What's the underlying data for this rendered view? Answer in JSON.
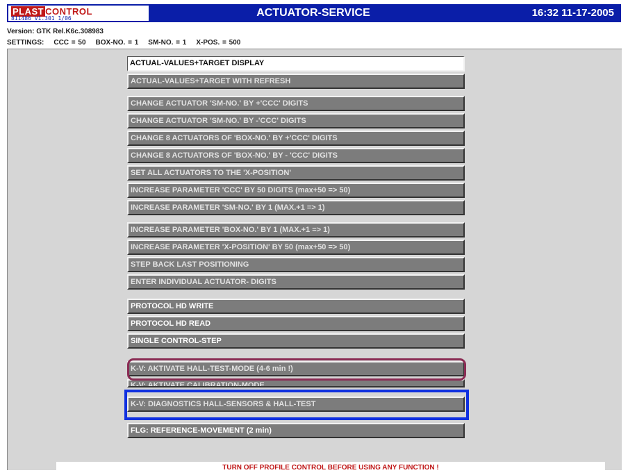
{
  "header": {
    "logo": {
      "part1": "PLAST",
      "part2": "CONTROL",
      "subline": "811486 V1.301 1/06"
    },
    "title": "ACTUATOR-SERVICE",
    "clock": "16:32 11-17-2005"
  },
  "version": "Version: GTK Rel.K6c.308983",
  "settings": {
    "label": "SETTINGS:",
    "ccc": "CCC = 50",
    "box_no": "BOX-NO. = 1",
    "sm_no": "SM-NO. = 1",
    "x_pos": "X-POS. = 500"
  },
  "menu": [
    "ACTUAL-VALUES+TARGET DISPLAY",
    "ACTUAL-VALUES+TARGET WITH REFRESH",
    "CHANGE ACTUATOR 'SM-NO.' BY +'CCC' DIGITS",
    "CHANGE ACTUATOR 'SM-NO.' BY -'CCC' DIGITS",
    "CHANGE 8 ACTUATORS OF 'BOX-NO.' BY +'CCC' DIGITS",
    "CHANGE 8 ACTUATORS OF 'BOX-NO.' BY - 'CCC' DIGITS",
    "SET ALL ACTUATORS TO THE 'X-POSITION'",
    "INCREASE PARAMETER 'CCC' BY 50 DIGITS (max+50 => 50)",
    "INCREASE PARAMETER 'SM-NO.' BY 1 (MAX.+1 => 1)",
    "INCREASE PARAMETER 'BOX-NO.' BY 1 (MAX.+1 => 1)",
    "INCREASE PARAMETER 'X-POSITION' BY 50 (max+50 => 50)",
    "STEP BACK LAST POSITIONING",
    "ENTER INDIVIDUAL ACTUATOR- DIGITS",
    "PROTOCOL HD WRITE",
    "PROTOCOL HD READ",
    "SINGLE CONTROL-STEP",
    "K-V: AKTIVATE HALL-TEST-MODE (4-6 min !)",
    "K-V: AKTIVATE CALIBRATION-MODE",
    "K-V: DIAGNOSTICS HALL-SENSORS & HALL-TEST",
    "FLG: REFERENCE-MOVEMENT (2 min)"
  ],
  "warning": "TURN OFF PROFILE CONTROL BEFORE USING ANY FUNCTION !",
  "colors": {
    "title_bar": "#0a1ea8",
    "button_face": "#7c7c7c",
    "panel": "#d6d6d6",
    "warning_text": "#c01818",
    "highlight_purple": "#8a2c54",
    "highlight_blue": "#1030e0"
  }
}
